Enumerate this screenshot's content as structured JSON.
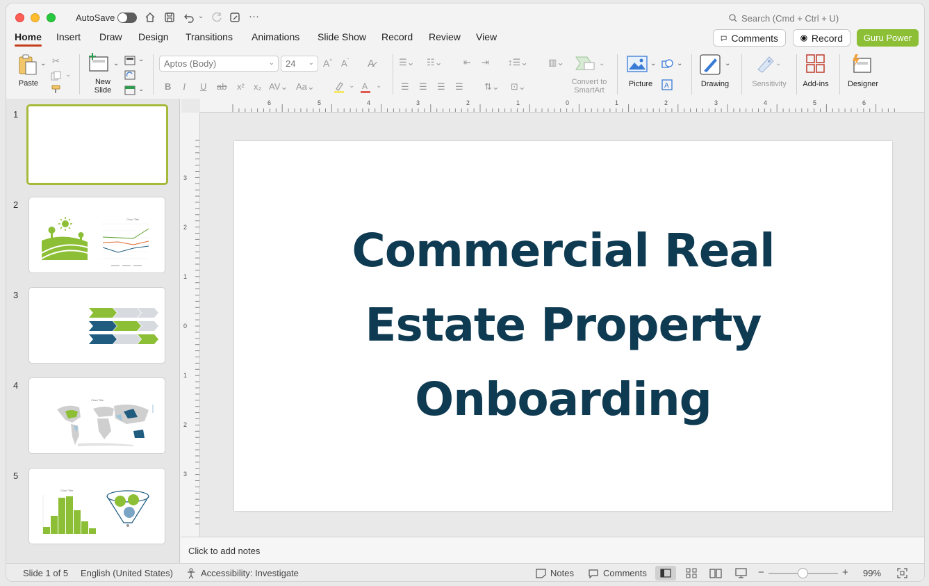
{
  "titlebar": {
    "autosave_label": "AutoSave",
    "search_placeholder": "Search (Cmd + Ctrl + U)"
  },
  "tabs": [
    {
      "label": "Home"
    },
    {
      "label": "Insert"
    },
    {
      "label": "Draw"
    },
    {
      "label": "Design"
    },
    {
      "label": "Transitions"
    },
    {
      "label": "Animations"
    },
    {
      "label": "Slide Show"
    },
    {
      "label": "Record"
    },
    {
      "label": "Review"
    },
    {
      "label": "View"
    }
  ],
  "header_buttons": {
    "comments": "Comments",
    "record": "Record",
    "guru": "Guru Power"
  },
  "ribbon": {
    "paste": "Paste",
    "new_slide": "New\nSlide",
    "font_name": "Aptos (Body)",
    "font_size": "24",
    "convert_smartart": "Convert to\nSmartArt",
    "picture": "Picture",
    "drawing": "Drawing",
    "sensitivity": "Sensitivity",
    "addins": "Add-ins",
    "designer": "Designer"
  },
  "thumbnails": [
    {
      "number": "1"
    },
    {
      "number": "2"
    },
    {
      "number": "3"
    },
    {
      "number": "4"
    },
    {
      "number": "5"
    }
  ],
  "thumb_chart_title": "Chart Title",
  "ruler": {
    "h_ticks": [
      "6",
      "5",
      "4",
      "3",
      "2",
      "1",
      "0",
      "1",
      "2",
      "3",
      "4",
      "5",
      "6"
    ],
    "v_ticks": [
      "3",
      "2",
      "1",
      "0",
      "1",
      "2",
      "3"
    ]
  },
  "slide": {
    "title_lines": [
      "Commercial Real",
      "Estate Property",
      "Onboarding"
    ]
  },
  "notes_placeholder": "Click to add notes",
  "status": {
    "slide_count": "Slide 1 of 5",
    "language": "English (United States)",
    "accessibility": "Accessibility: Investigate",
    "notes": "Notes",
    "comments": "Comments",
    "zoom": "99%"
  },
  "colors": {
    "accent_green": "#8cbf35",
    "title_navy": "#0e3a52",
    "tab_underline": "#c43e1c"
  }
}
